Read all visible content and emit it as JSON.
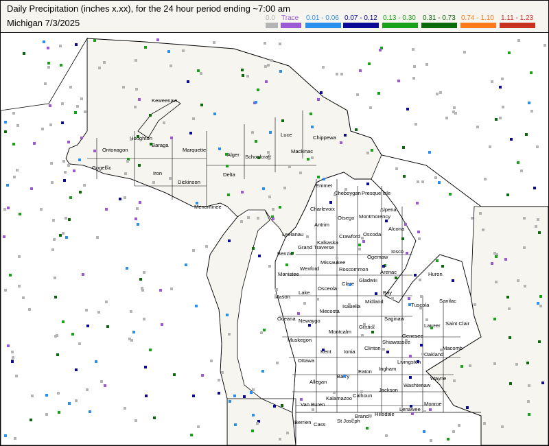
{
  "header": {
    "title": "Daily Precipitation (inches  x.xx),  for the 24 hour period ending ~7:00 am",
    "subtitle": "Michigan 7/3/2025"
  },
  "legend": [
    {
      "label": "0.0",
      "color": "#b4b4b4"
    },
    {
      "label": "Trace",
      "color": "#9b59d6"
    },
    {
      "label": "0.01 - 0.06",
      "color": "#2b8ff0"
    },
    {
      "label": "0.07 - 0.12",
      "color": "#0a0a96"
    },
    {
      "label": "0.13 - 0.30",
      "color": "#1aa11a"
    },
    {
      "label": "0.31 - 0.73",
      "color": "#0b6b0b"
    },
    {
      "label": "0.74 - 1.10",
      "color": "#ff7a1a"
    },
    {
      "label": "1.11 - 1.23",
      "color": "#c8321e"
    }
  ],
  "counties": [
    "Keweenaw",
    "Houghton",
    "Baraga",
    "Ontonagon",
    "Gogebic",
    "Iron",
    "Marquette",
    "Alger",
    "Schoolcraft",
    "Luce",
    "Chippewa",
    "Mackinac",
    "Dickinson",
    "Delta",
    "Menominee",
    "Emmet",
    "Cheboygan",
    "Presque Isle",
    "Charlevoix",
    "Otsego",
    "Montmorency",
    "Alpena",
    "Antrim",
    "Leelanau",
    "Kalkaska",
    "Crawford",
    "Oscoda",
    "Alcona",
    "Benzie",
    "Grand Traverse",
    "Missaukee",
    "Roscommon",
    "Ogemaw",
    "Iosco",
    "Manistee",
    "Wexford",
    "Arenac",
    "Huron",
    "Mason",
    "Lake",
    "Osceola",
    "Clare",
    "Gladwin",
    "Bay",
    "Tuscola",
    "Sanilac",
    "Oceana",
    "Newaygo",
    "Mecosta",
    "Isabella",
    "Midland",
    "Saginaw",
    "Lapeer",
    "Saint Clair",
    "Muskegon",
    "Montcalm",
    "Gratiot",
    "Genesee",
    "Ottawa",
    "Kent",
    "Ionia",
    "Clinton",
    "Shiawassee",
    "Livingston",
    "Oakland",
    "Macomb",
    "Allegan",
    "Barry",
    "Eaton",
    "Ingham",
    "Wayne",
    "Washtenaw",
    "Van Buren",
    "Kalamazoo",
    "Calhoun",
    "Jackson",
    "Monroe",
    "Lenawee",
    "Hillsdale",
    "Branch",
    "Berrien",
    "Cass",
    "St Joseph"
  ]
}
